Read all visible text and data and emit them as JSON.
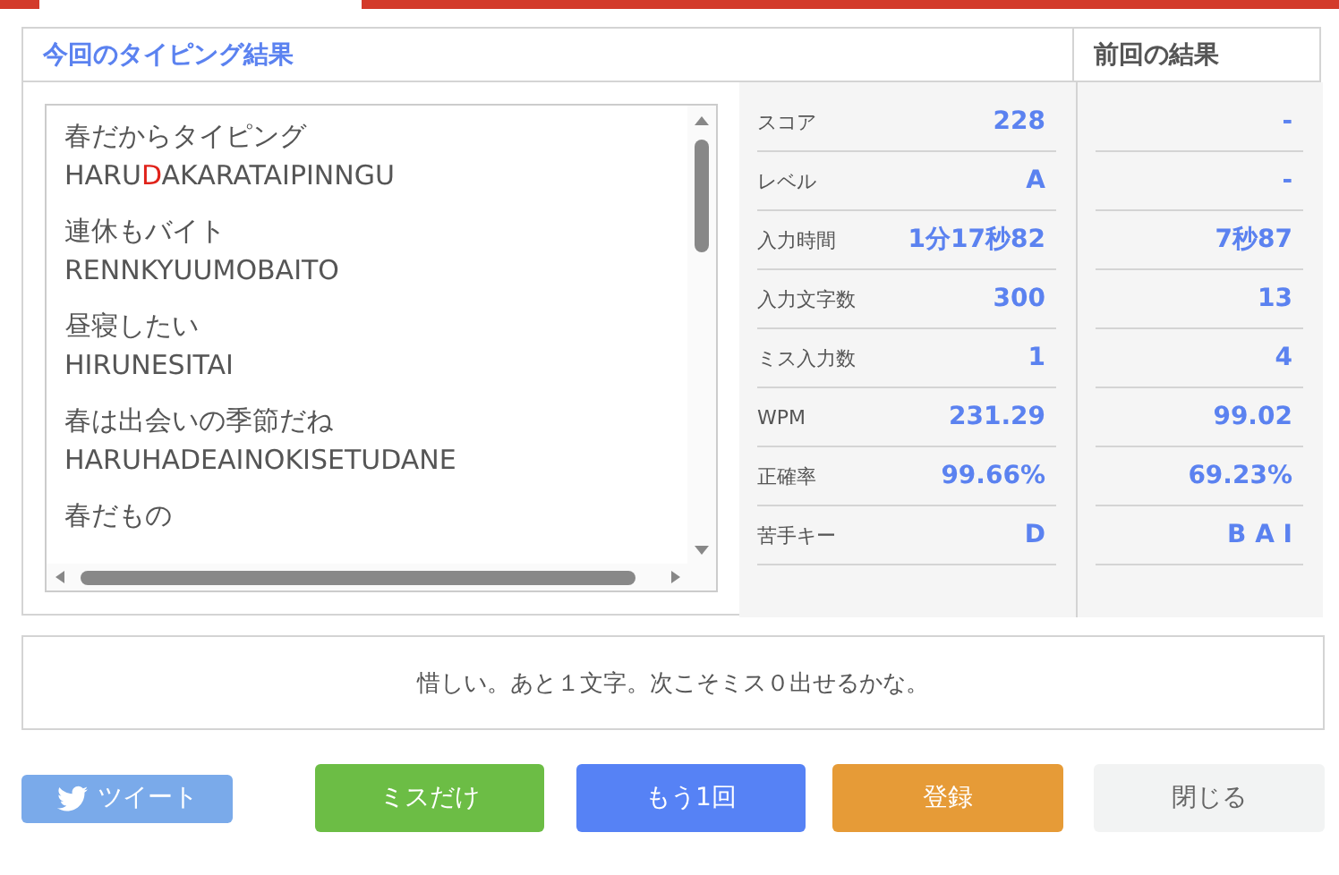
{
  "current_title": "今回のタイピング結果",
  "previous_title": "前回の結果",
  "phrases": [
    {
      "text": "春だからタイピング",
      "romaji": [
        {
          "text": "HARU",
          "miss": false
        },
        {
          "text": "D",
          "miss": true
        },
        {
          "text": "AKARATAIPINNGU",
          "miss": false
        }
      ]
    },
    {
      "text": "連休もバイト",
      "romaji": [
        {
          "text": "RENNKYUUMOBAITO",
          "miss": false
        }
      ]
    },
    {
      "text": "昼寝したい",
      "romaji": [
        {
          "text": "HIRUNESITAI",
          "miss": false
        }
      ]
    },
    {
      "text": "春は出会いの季節だね",
      "romaji": [
        {
          "text": "HARUHADEAINOKISETUDANE",
          "miss": false
        }
      ]
    },
    {
      "text": "春だもの"
    }
  ],
  "stats": [
    {
      "label": "スコア",
      "current": "228",
      "previous": "-"
    },
    {
      "label": "レベル",
      "current": "A",
      "previous": "-"
    },
    {
      "label": "入力時間",
      "current": "1分17秒82",
      "previous": "7秒87"
    },
    {
      "label": "入力文字数",
      "current": "300",
      "previous": "13"
    },
    {
      "label": "ミス入力数",
      "current": "1",
      "previous": "4"
    },
    {
      "label": "WPM",
      "current": "231.29",
      "previous": "99.02"
    },
    {
      "label": "正確率",
      "current": "99.66%",
      "previous": "69.23%"
    },
    {
      "label": "苦手キー",
      "current": "D",
      "previous": "B A I"
    }
  ],
  "message": "惜しい。あと１文字。次こそミス０出せるかな。",
  "buttons": [
    {
      "label": "ツイート",
      "kind": "tweet"
    },
    {
      "label": "ミスだけ",
      "kind": "green"
    },
    {
      "label": "もう1回",
      "kind": "blue"
    },
    {
      "label": "登録",
      "kind": "orange"
    },
    {
      "label": "閉じる",
      "kind": "plain"
    }
  ]
}
